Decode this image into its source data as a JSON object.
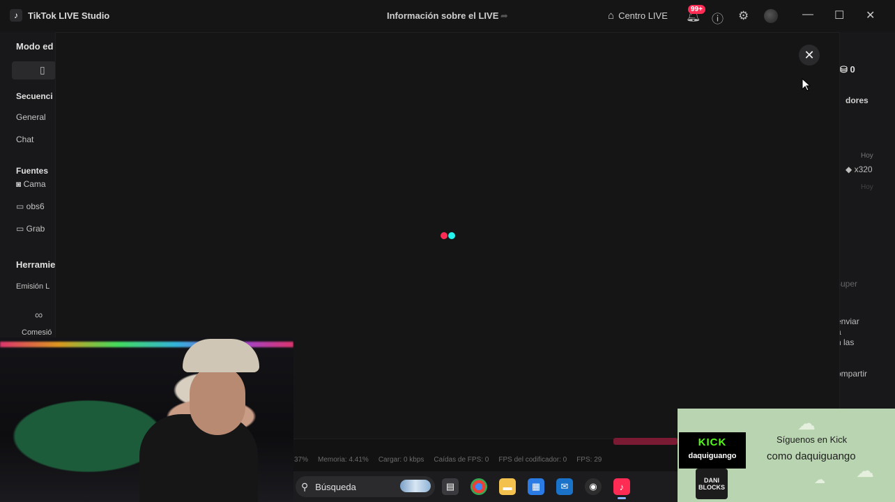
{
  "titlebar": {
    "app_title": "TikTok LIVE Studio",
    "center_title": "Información sobre el LIVE",
    "live_center_label": "Centro LIVE",
    "notification_badge": "99+"
  },
  "sidebar": {
    "heading_mode": "Modo ed",
    "heading_sequence": "Secuenci",
    "item_general": "General",
    "item_chat": "Chat",
    "heading_sources": "Fuentes",
    "source_camera": "Cama",
    "source_obs": "obs6",
    "source_recording": "Grab",
    "heading_tools": "Herramie",
    "tool_emission": "Emisión L",
    "tool_commission": "Comesió"
  },
  "right_edge": {
    "coin_count": "0",
    "viewers_label": "dores",
    "today_label": "Hoy",
    "gift_count": "x320",
    "today_label_2": "Hoy",
    "super_label": "Super",
    "send_text_1": "enviar",
    "send_text_2": "a",
    "send_text_3": "n las",
    "share_label": "ompartir"
  },
  "status_bar": {
    "cpu": "37%",
    "memory": "Memoria: 4.41%",
    "upload": "Cargar: 0 kbps",
    "fps_drops": "Caídas de FPS: 0",
    "encoder_fps": "FPS del codificador: 0",
    "fps": "FPS: 29"
  },
  "taskbar": {
    "search_placeholder": "Búsqueda"
  },
  "kick_banner": {
    "kick_word": "KICK",
    "kick_user": "daquiguango",
    "badge_text": "DANI BLOCKS",
    "line1": "Síguenos en Kick",
    "line2": "como daquiguango"
  },
  "colors": {
    "tiktok_red": "#fe2c55",
    "tiktok_cyan": "#25f4ee",
    "kick_green": "#53fc18"
  }
}
